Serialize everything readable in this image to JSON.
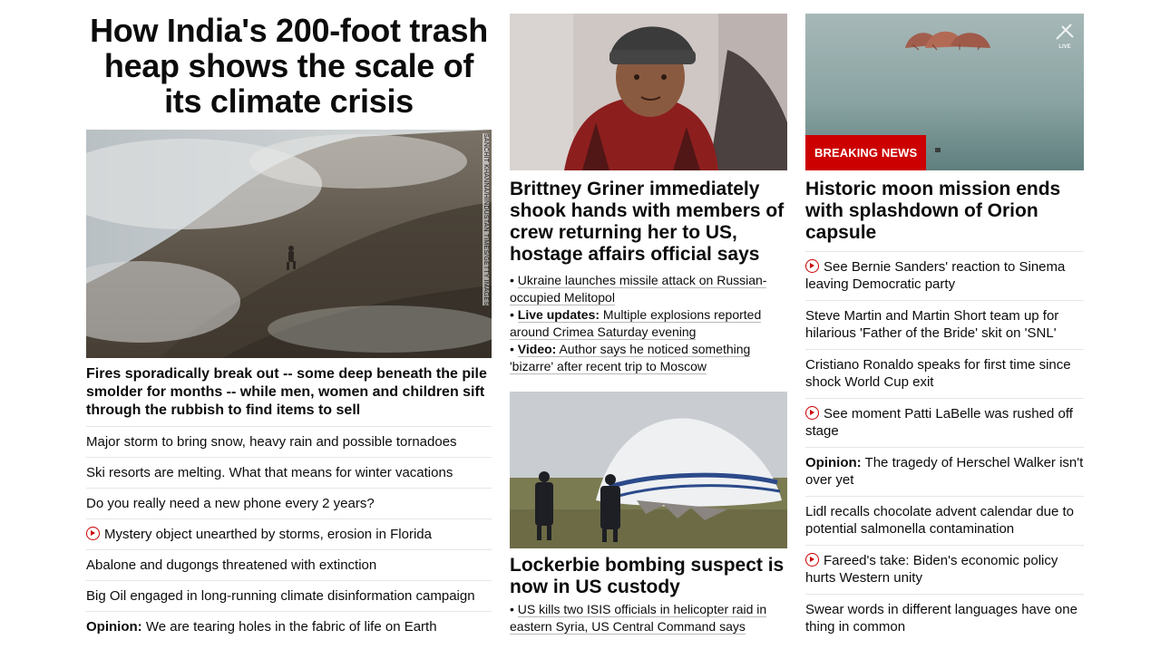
{
  "lead": {
    "headline": "How India's 200-foot trash heap shows the scale of its climate crisis",
    "image_credit": "SANCHIT KHANNA/HINDUSTAN TIMES/GETTY IMAGES",
    "caption": "Fires sporadically break out -- some deep beneath the pile smolder for months -- while men, women and children sift through the rubbish to find items to sell",
    "stories": [
      {
        "text": "Major storm to bring snow, heavy rain and possible tornadoes"
      },
      {
        "text": "Ski resorts are melting. What that means for winter vacations"
      },
      {
        "text": "Do you really need a new phone every 2 years?"
      },
      {
        "video": true,
        "text": "Mystery object unearthed by storms, erosion in Florida"
      },
      {
        "text": "Abalone and dugongs threatened with extinction"
      },
      {
        "text": "Big Oil engaged in long-running climate disinformation campaign"
      },
      {
        "kicker": "Opinion:",
        "text": " We are tearing holes in the fabric of life on Earth"
      }
    ]
  },
  "griner": {
    "headline": "Brittney Griner immediately shook hands with members of crew returning her to US, hostage affairs official says",
    "bullets": [
      {
        "text": "Ukraine launches missile attack on Russian-occupied Melitopol"
      },
      {
        "kicker": "Live updates:",
        "text": " Multiple explosions reported around Crimea Saturday evening"
      },
      {
        "kicker": "Video:",
        "text": " Author says he noticed something 'bizarre' after recent trip to Moscow"
      }
    ]
  },
  "lockerbie": {
    "headline": "Lockerbie bombing suspect is now in US custody",
    "bullets": [
      {
        "text": "US kills two ISIS officials in helicopter raid in eastern Syria, US Central Command says"
      }
    ]
  },
  "orion": {
    "badge": "BREAKING NEWS",
    "live_label": "LIVE",
    "headline": "Historic moon mission ends with splashdown of Orion capsule",
    "stories": [
      {
        "video": true,
        "text": "See Bernie Sanders' reaction to Sinema leaving Democratic party"
      },
      {
        "text": "Steve Martin and Martin Short team up for hilarious 'Father of the Bride' skit on 'SNL'"
      },
      {
        "text": "Cristiano Ronaldo speaks for first time since shock World Cup exit"
      },
      {
        "video": true,
        "text": "See moment Patti LaBelle was rushed off stage"
      },
      {
        "kicker": "Opinion:",
        "text": " The tragedy of Herschel Walker isn't over yet"
      },
      {
        "text": "Lidl recalls chocolate advent calendar due to potential salmonella contamination"
      },
      {
        "video": true,
        "text": "Fareed's take: Biden's economic policy hurts Western unity"
      },
      {
        "text": "Swear words in different languages have one thing in common"
      }
    ]
  },
  "colors": {
    "accent": "#cc0000",
    "text": "#0c0c0c",
    "divider": "#e6e6e6"
  }
}
